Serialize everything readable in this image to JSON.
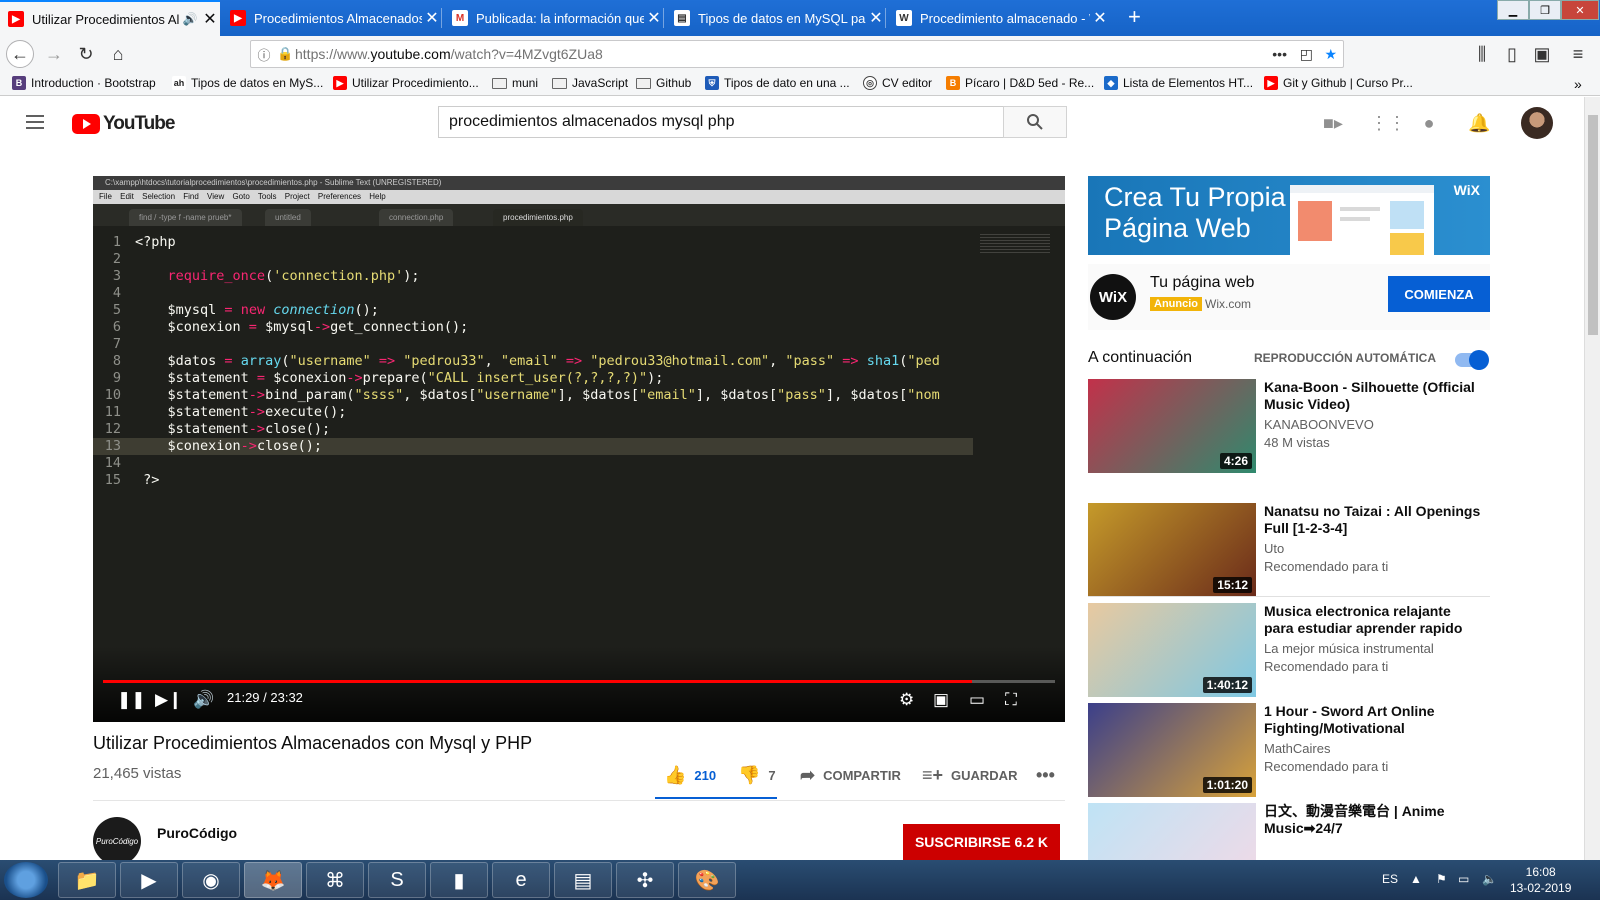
{
  "browser": {
    "tabs": [
      {
        "title": "Utilizar Procedimientos Alm",
        "favicon": "youtube-icon",
        "color": "#ff0000",
        "active": true
      },
      {
        "title": "Procedimientos Almacenados I",
        "favicon": "youtube-icon",
        "color": "#ff0000"
      },
      {
        "title": "Publicada: la información que",
        "favicon": "gmail-icon",
        "color": "#d93025"
      },
      {
        "title": "Tipos de datos en MySQL para",
        "favicon": "page-icon",
        "color": "#555555"
      },
      {
        "title": "Procedimiento almacenado - W",
        "favicon": "wikipedia-icon",
        "color": "#333333"
      }
    ],
    "url_prefix": "https://www.",
    "url_host": "youtube.com",
    "url_path": "/watch?v=4MZvgt6ZUa8",
    "bookmarks": [
      {
        "label": "Introduction · Bootstrap",
        "icon": "bootstrap-icon",
        "color": "#563d7c"
      },
      {
        "label": "Tipos de datos en MyS...",
        "icon": "ah-icon",
        "color": "#222222"
      },
      {
        "label": "Utilizar Procedimiento...",
        "icon": "youtube-icon",
        "color": "#ff0000"
      },
      {
        "label": "muni",
        "icon": "folder-icon"
      },
      {
        "label": "JavaScript",
        "icon": "folder-icon"
      },
      {
        "label": "Github",
        "icon": "folder-icon"
      },
      {
        "label": "Tipos de dato en una ...",
        "icon": "shield-icon",
        "color": "#1e5bb8"
      },
      {
        "label": "CV editor",
        "icon": "globe-icon",
        "color": "#444444"
      },
      {
        "label": "Pícaro | D&D 5ed - Re...",
        "icon": "blogger-icon",
        "color": "#f57d00"
      },
      {
        "label": "Lista de Elementos HT...",
        "icon": "ht-icon",
        "color": "#1b6ac9"
      },
      {
        "label": "Git y Github | Curso Pr...",
        "icon": "youtube-icon",
        "color": "#ff0000"
      }
    ]
  },
  "youtube": {
    "logo_text": "YouTube",
    "search_query": "procedimientos almacenados mysql php",
    "video": {
      "title": "Utilizar Procedimientos Almacenados con Mysql y PHP",
      "views": "21,465 vistas",
      "likes": "210",
      "dislikes": "7",
      "share": "COMPARTIR",
      "save": "GUARDAR",
      "time": "21:29 / 23:32",
      "progress_fraction": 0.913
    },
    "editor": {
      "window_title": "C:\\xampp\\htdocs\\tutorialprocedimientos\\procedimientos.php - Sublime Text (UNREGISTERED)",
      "menu": "File Edit Selection Find View Goto Tools Project Preferences Help",
      "tabs": [
        "find / -type f -name prueb*",
        "untitled",
        "connection.php",
        "procedimientos.php"
      ]
    },
    "channel": {
      "name": "PuroCódigo",
      "avatar_text": "PuroCódigo",
      "subscribe": "SUSCRIBIRSE  6.2 K"
    },
    "ad": {
      "banner_line1": "Crea Tu Propia",
      "banner_line2": "Página Web",
      "brand": "WiX",
      "title": "Tu página web",
      "badge": "Anuncio",
      "domain": "Wix.com",
      "cta": "COMIENZA"
    },
    "up_next": "A continuación",
    "autoplay": "REPRODUCCIÓN AUTOMÁTICA",
    "recommendations": [
      {
        "title": "Kana-Boon - Silhouette (Official Music Video)",
        "channel": "KANABOONVEVO",
        "meta": "48 M vistas",
        "duration": "4:26",
        "c1": "#c2314a",
        "c2": "#2f8a6e"
      },
      {
        "title": "Nanatsu no Taizai : All Openings Full [1-2-3-4]",
        "channel": "Uto",
        "meta": "Recomendado para ti",
        "duration": "15:12",
        "c1": "#c59a2a",
        "c2": "#6a2a1a"
      },
      {
        "title": "Musica electronica relajante para estudiar aprender rapido",
        "channel": "La mejor música instrumental",
        "meta": "Recomendado para ti",
        "duration": "1:40:12",
        "c1": "#e8c9a0",
        "c2": "#7ec8e3"
      },
      {
        "title": "1 Hour - Sword Art Online Fighting/Motivational",
        "channel": "MathCaires",
        "meta": "Recomendado para ti",
        "duration": "1:01:20",
        "c1": "#3b3f8a",
        "c2": "#d8a23a"
      },
      {
        "title": "日文、動漫音樂電台 | Anime Music➡24/7",
        "channel": "",
        "meta": "",
        "duration": "",
        "c1": "#bfe3f5",
        "c2": "#f3d9e6"
      }
    ]
  },
  "taskbar": {
    "lang": "ES",
    "time": "16:08",
    "date": "13-02-2019"
  }
}
